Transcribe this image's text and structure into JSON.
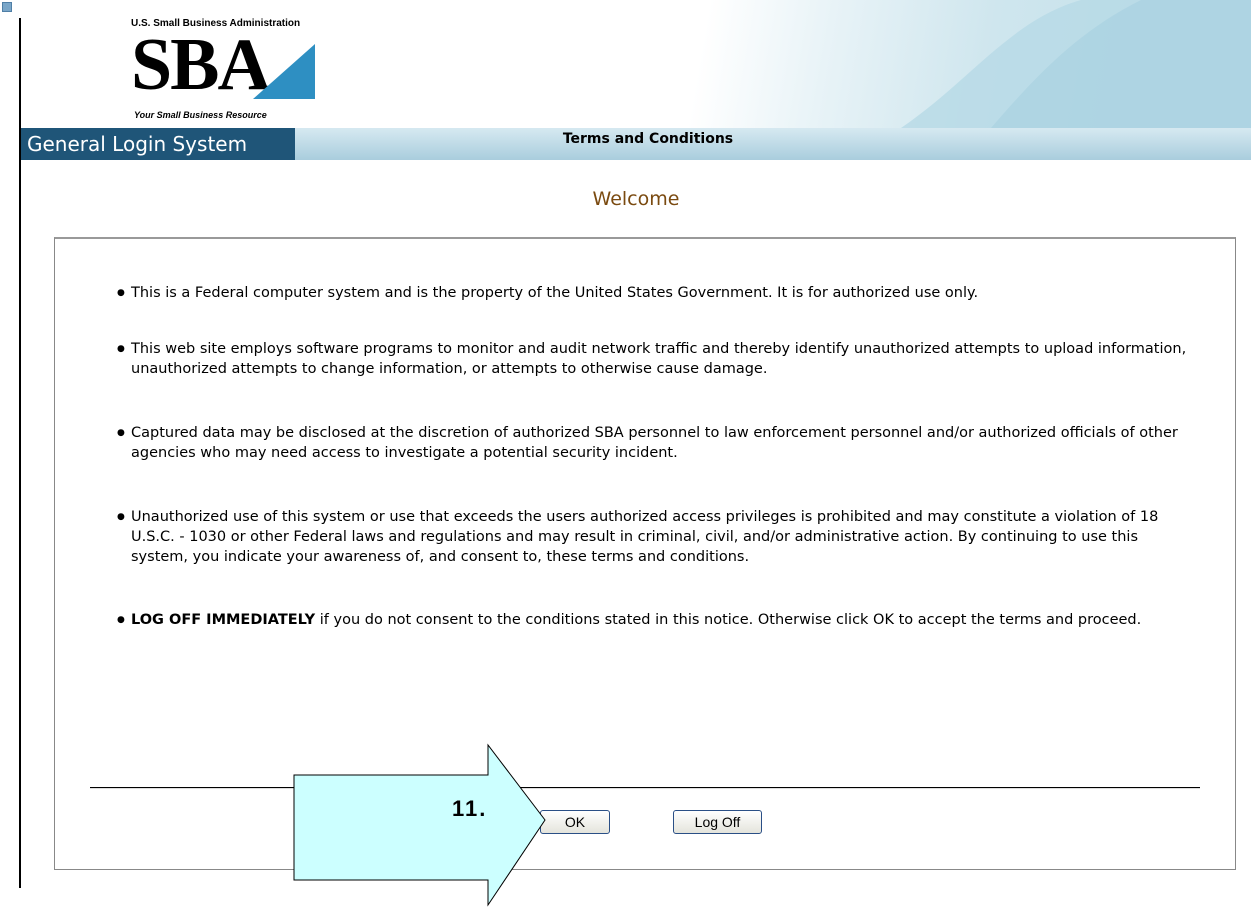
{
  "header": {
    "logo_top_text": "U.S. Small Business Administration",
    "logo_main_text": "SBA",
    "logo_tagline": "Your Small Business Resource",
    "system_title": "General Login System",
    "page_heading": "Terms and Conditions"
  },
  "main": {
    "welcome": "Welcome",
    "terms": [
      {
        "text": "This is a Federal computer system and is the property of the United States Government. It is for authorized use only."
      },
      {
        "text": "This web site employs software programs to monitor and audit network traffic and thereby identify unauthorized attempts to upload information, unauthorized attempts to change information, or attempts to otherwise cause damage."
      },
      {
        "text": "Captured data may be disclosed at the discretion of authorized SBA personnel to law enforcement personnel and/or authorized officials of other agencies who may need access to investigate a potential security incident."
      },
      {
        "text": "Unauthorized use of this system or use that exceeds the users authorized access privileges is prohibited and may constitute a violation of 18 U.S.C. - 1030 or other Federal laws and regulations and may result in criminal, civil, and/or administrative action. By continuing to use this system, you indicate your awareness of, and consent to, these terms and conditions."
      },
      {
        "bold": "LOG OFF IMMEDIATELY",
        "text": " if you do not consent to the conditions stated in this notice. Otherwise click OK to accept the terms and proceed."
      }
    ],
    "ok_label": "OK",
    "logoff_label": "Log Off"
  },
  "annotation": {
    "step_label": "11.",
    "arrow_color": "#ccffff"
  }
}
